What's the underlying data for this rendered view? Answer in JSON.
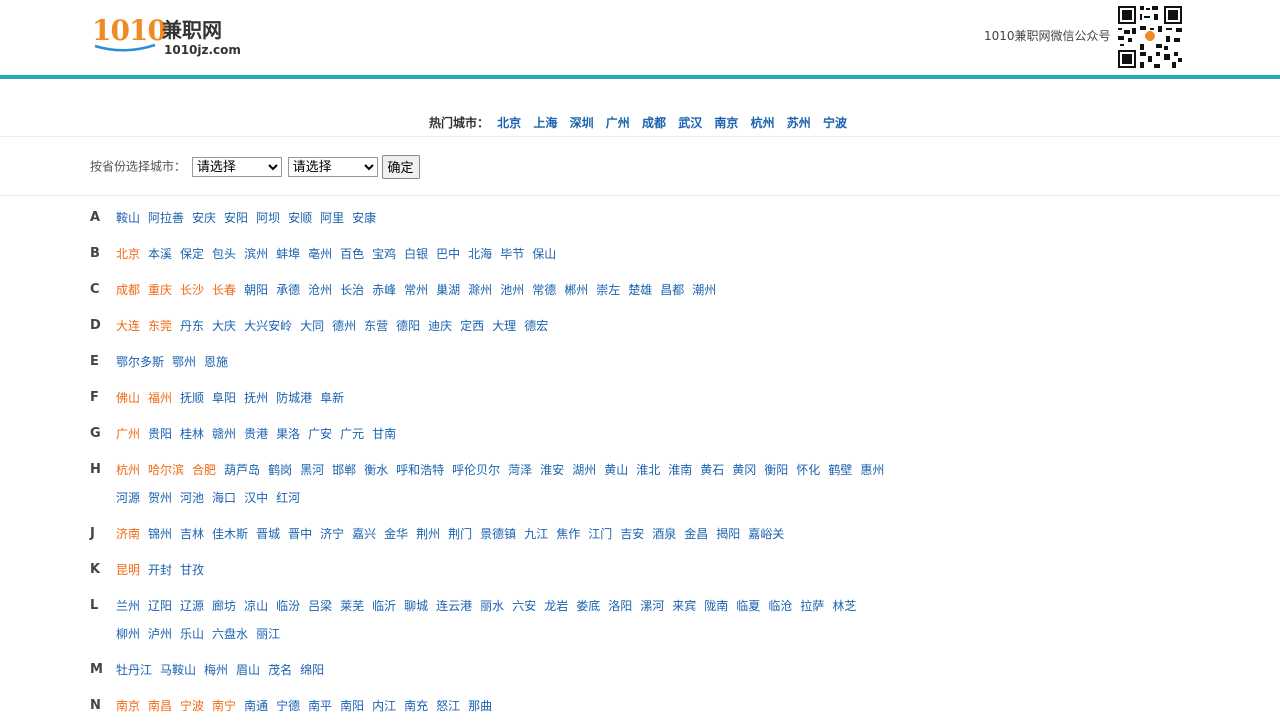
{
  "logo": {
    "num": "1010",
    "cn": "兼职网",
    "domain": "1010jz.com"
  },
  "wechat_label": "1010兼职网微信公众号",
  "hot": {
    "label": "热门城市：",
    "cities": [
      "北京",
      "上海",
      "深圳",
      "广州",
      "成都",
      "武汉",
      "南京",
      "杭州",
      "苏州",
      "宁波"
    ]
  },
  "province": {
    "label": "按省份选择城市：",
    "select1": "请选择",
    "select2": "请选择",
    "confirm": "确定"
  },
  "groups": [
    {
      "letter": "A",
      "cities": [
        [
          "鞍山",
          0
        ],
        [
          "阿拉善",
          0
        ],
        [
          "安庆",
          0
        ],
        [
          "安阳",
          0
        ],
        [
          "阿坝",
          0
        ],
        [
          "安顺",
          0
        ],
        [
          "阿里",
          0
        ],
        [
          "安康",
          0
        ]
      ]
    },
    {
      "letter": "B",
      "cities": [
        [
          "北京",
          1
        ],
        [
          "本溪",
          0
        ],
        [
          "保定",
          0
        ],
        [
          "包头",
          0
        ],
        [
          "滨州",
          0
        ],
        [
          "蚌埠",
          0
        ],
        [
          "亳州",
          0
        ],
        [
          "百色",
          0
        ],
        [
          "宝鸡",
          0
        ],
        [
          "白银",
          0
        ],
        [
          "巴中",
          0
        ],
        [
          "北海",
          0
        ],
        [
          "毕节",
          0
        ],
        [
          "保山",
          0
        ]
      ]
    },
    {
      "letter": "C",
      "cities": [
        [
          "成都",
          1
        ],
        [
          "重庆",
          1
        ],
        [
          "长沙",
          1
        ],
        [
          "长春",
          1
        ],
        [
          "朝阳",
          0
        ],
        [
          "承德",
          0
        ],
        [
          "沧州",
          0
        ],
        [
          "长治",
          0
        ],
        [
          "赤峰",
          0
        ],
        [
          "常州",
          0
        ],
        [
          "巢湖",
          0
        ],
        [
          "滁州",
          0
        ],
        [
          "池州",
          0
        ],
        [
          "常德",
          0
        ],
        [
          "郴州",
          0
        ],
        [
          "崇左",
          0
        ],
        [
          "楚雄",
          0
        ],
        [
          "昌都",
          0
        ],
        [
          "潮州",
          0
        ]
      ]
    },
    {
      "letter": "D",
      "cities": [
        [
          "大连",
          1
        ],
        [
          "东莞",
          1
        ],
        [
          "丹东",
          0
        ],
        [
          "大庆",
          0
        ],
        [
          "大兴安岭",
          0
        ],
        [
          "大同",
          0
        ],
        [
          "德州",
          0
        ],
        [
          "东营",
          0
        ],
        [
          "德阳",
          0
        ],
        [
          "迪庆",
          0
        ],
        [
          "定西",
          0
        ],
        [
          "大理",
          0
        ],
        [
          "德宏",
          0
        ]
      ]
    },
    {
      "letter": "E",
      "cities": [
        [
          "鄂尔多斯",
          0
        ],
        [
          "鄂州",
          0
        ],
        [
          "恩施",
          0
        ]
      ]
    },
    {
      "letter": "F",
      "cities": [
        [
          "佛山",
          1
        ],
        [
          "福州",
          1
        ],
        [
          "抚顺",
          0
        ],
        [
          "阜阳",
          0
        ],
        [
          "抚州",
          0
        ],
        [
          "防城港",
          0
        ],
        [
          "阜新",
          0
        ]
      ]
    },
    {
      "letter": "G",
      "cities": [
        [
          "广州",
          1
        ],
        [
          "贵阳",
          0
        ],
        [
          "桂林",
          0
        ],
        [
          "赣州",
          0
        ],
        [
          "贵港",
          0
        ],
        [
          "果洛",
          0
        ],
        [
          "广安",
          0
        ],
        [
          "广元",
          0
        ],
        [
          "甘南",
          0
        ]
      ]
    },
    {
      "letter": "H",
      "cities": [
        [
          "杭州",
          1
        ],
        [
          "哈尔滨",
          1
        ],
        [
          "合肥",
          1
        ],
        [
          "葫芦岛",
          0
        ],
        [
          "鹤岗",
          0
        ],
        [
          "黑河",
          0
        ],
        [
          "邯郸",
          0
        ],
        [
          "衡水",
          0
        ],
        [
          "呼和浩特",
          0
        ],
        [
          "呼伦贝尔",
          0
        ],
        [
          "菏泽",
          0
        ],
        [
          "淮安",
          0
        ],
        [
          "湖州",
          0
        ],
        [
          "黄山",
          0
        ],
        [
          "淮北",
          0
        ],
        [
          "淮南",
          0
        ],
        [
          "黄石",
          0
        ],
        [
          "黄冈",
          0
        ],
        [
          "衡阳",
          0
        ],
        [
          "怀化",
          0
        ],
        [
          "鹤壁",
          0
        ],
        [
          "惠州",
          0
        ],
        [
          "河源",
          0
        ],
        [
          "贺州",
          0
        ],
        [
          "河池",
          0
        ],
        [
          "海口",
          0
        ],
        [
          "汉中",
          0
        ],
        [
          "红河",
          0
        ]
      ]
    },
    {
      "letter": "J",
      "cities": [
        [
          "济南",
          1
        ],
        [
          "锦州",
          0
        ],
        [
          "吉林",
          0
        ],
        [
          "佳木斯",
          0
        ],
        [
          "晋城",
          0
        ],
        [
          "晋中",
          0
        ],
        [
          "济宁",
          0
        ],
        [
          "嘉兴",
          0
        ],
        [
          "金华",
          0
        ],
        [
          "荆州",
          0
        ],
        [
          "荆门",
          0
        ],
        [
          "景德镇",
          0
        ],
        [
          "九江",
          0
        ],
        [
          "焦作",
          0
        ],
        [
          "江门",
          0
        ],
        [
          "吉安",
          0
        ],
        [
          "酒泉",
          0
        ],
        [
          "金昌",
          0
        ],
        [
          "揭阳",
          0
        ],
        [
          "嘉峪关",
          0
        ]
      ]
    },
    {
      "letter": "K",
      "cities": [
        [
          "昆明",
          1
        ],
        [
          "开封",
          0
        ],
        [
          "甘孜",
          0
        ]
      ]
    },
    {
      "letter": "L",
      "cities": [
        [
          "兰州",
          0
        ],
        [
          "辽阳",
          0
        ],
        [
          "辽源",
          0
        ],
        [
          "廊坊",
          0
        ],
        [
          "凉山",
          0
        ],
        [
          "临汾",
          0
        ],
        [
          "吕梁",
          0
        ],
        [
          "莱芜",
          0
        ],
        [
          "临沂",
          0
        ],
        [
          "聊城",
          0
        ],
        [
          "连云港",
          0
        ],
        [
          "丽水",
          0
        ],
        [
          "六安",
          0
        ],
        [
          "龙岩",
          0
        ],
        [
          "娄底",
          0
        ],
        [
          "洛阳",
          0
        ],
        [
          "漯河",
          0
        ],
        [
          "来宾",
          0
        ],
        [
          "陇南",
          0
        ],
        [
          "临夏",
          0
        ],
        [
          "临沧",
          0
        ],
        [
          "拉萨",
          0
        ],
        [
          "林芝",
          0
        ],
        [
          "柳州",
          0
        ],
        [
          "泸州",
          0
        ],
        [
          "乐山",
          0
        ],
        [
          "六盘水",
          0
        ],
        [
          "丽江",
          0
        ]
      ]
    },
    {
      "letter": "M",
      "cities": [
        [
          "牡丹江",
          0
        ],
        [
          "马鞍山",
          0
        ],
        [
          "梅州",
          0
        ],
        [
          "眉山",
          0
        ],
        [
          "茂名",
          0
        ],
        [
          "绵阳",
          0
        ]
      ]
    },
    {
      "letter": "N",
      "cities": [
        [
          "南京",
          1
        ],
        [
          "南昌",
          1
        ],
        [
          "宁波",
          1
        ],
        [
          "南宁",
          1
        ],
        [
          "南通",
          0
        ],
        [
          "宁德",
          0
        ],
        [
          "南平",
          0
        ],
        [
          "南阳",
          0
        ],
        [
          "内江",
          0
        ],
        [
          "南充",
          0
        ],
        [
          "怒江",
          0
        ],
        [
          "那曲",
          0
        ]
      ]
    }
  ]
}
